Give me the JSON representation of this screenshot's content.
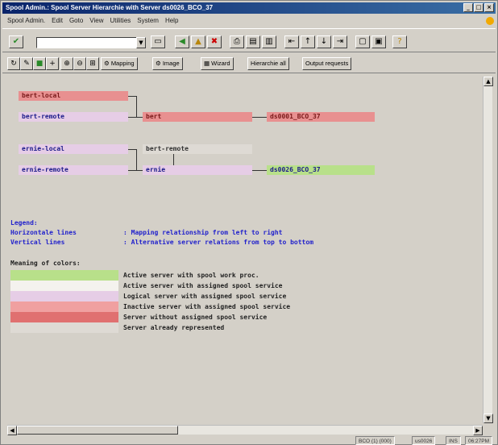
{
  "window": {
    "title": "Spool Admin.: Spool Server Hierarchie with Server ds0026_BCO_37"
  },
  "menu": [
    "Spool Admin.",
    "Edit",
    "Goto",
    "View",
    "Utilities",
    "System",
    "Help"
  ],
  "toolbar2": {
    "mapping_label": "Mapping",
    "image_label": "Image",
    "wizard_label": "Wizard",
    "hierarchie_label": "Hierarchie all",
    "output_label": "Output requests"
  },
  "diagram": {
    "nodes": {
      "bert_local": "bert-local",
      "bert_remote": "bert-remote",
      "bert": "bert",
      "server1": "ds0001_BCO_37",
      "ernie_local": "ernie-local",
      "bert_remote2": "bert-remote",
      "ernie_remote": "ernie-remote",
      "ernie": "ernie",
      "server2": "ds0026_BCO_37"
    }
  },
  "legend": {
    "title": "Legend:",
    "horizontal_label": "Horizontale lines",
    "horizontal_desc": ": Mapping relationship from left to right",
    "vertical_label": "Vertical lines",
    "vertical_desc": ": Alternative server relations from top to bottom",
    "colors_title": "Meaning of colors:",
    "colors": [
      {
        "color": "#b8e08a",
        "label": "Active server with spool work proc."
      },
      {
        "color": "#f4f2ee",
        "label": "Active server with assigned spool service"
      },
      {
        "color": "#e6cde6",
        "label": "Logical server with assigned spool service"
      },
      {
        "color": "#f0a0a0",
        "label": "Inactive server with assigned spool service"
      },
      {
        "color": "#e07070",
        "label": "Server without assigned spool service"
      },
      {
        "color": "#dedad4",
        "label": "Server already represented"
      }
    ]
  },
  "status": {
    "system": "BCO (1) (000)",
    "server": "us0026",
    "mode": "INS",
    "time": "06:27PM"
  }
}
